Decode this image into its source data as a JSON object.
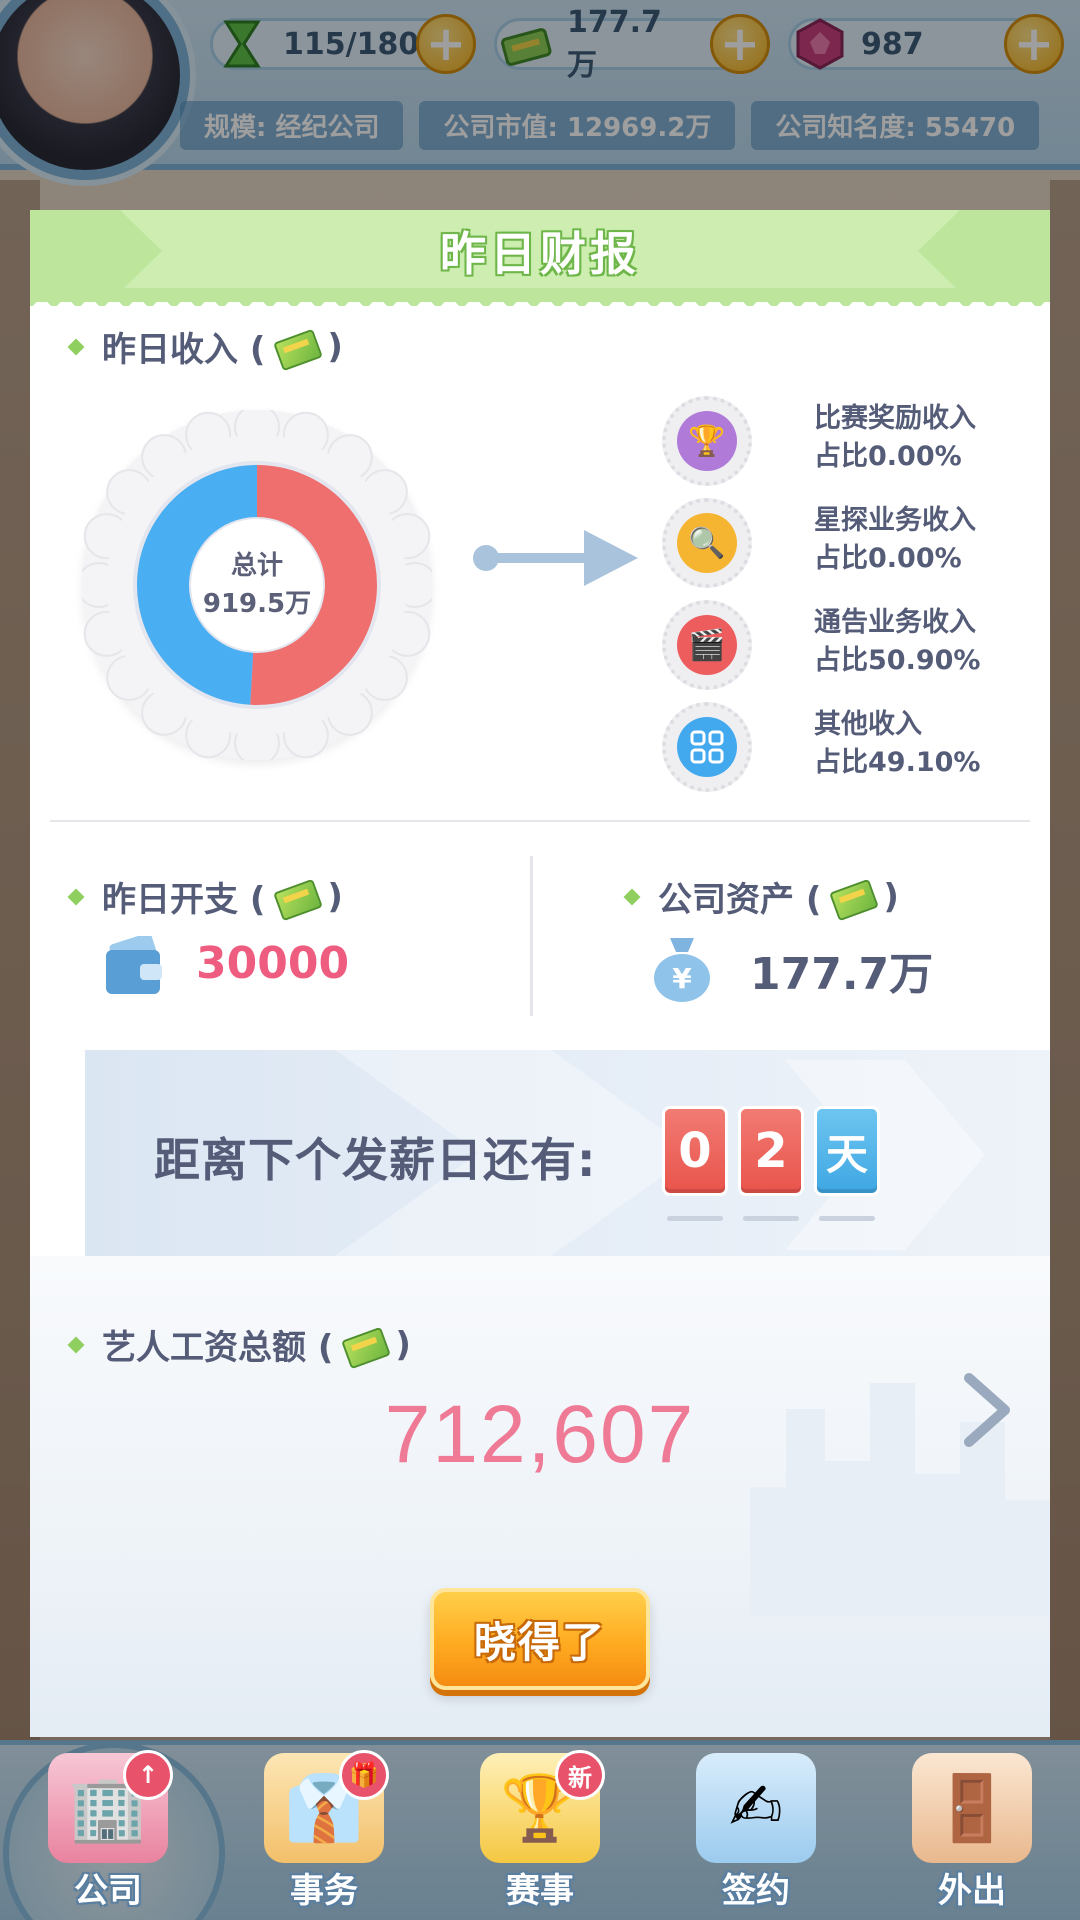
{
  "status": {
    "stamina": "115/180",
    "money": "177.7万",
    "gems": "987",
    "scale": "规模: 经纪公司",
    "market_value": "公司市值: 12969.2万",
    "fame": "公司知名度: 55470"
  },
  "modal": {
    "title": "昨日财报",
    "income": {
      "section_label": "昨日收入 (",
      "section_close": ")",
      "total_label": "总计",
      "total_value": "919.5万",
      "breakdown": [
        {
          "name": "比赛奖励收入",
          "share": "占比0.00%",
          "icon": "trophy-icon",
          "color": "#b07bd8"
        },
        {
          "name": "星探业务收入",
          "share": "占比0.00%",
          "icon": "magnifier-icon",
          "color": "#f5b531"
        },
        {
          "name": "通告业务收入",
          "share": "占比50.90%",
          "icon": "clapperboard-icon",
          "color": "#ee5d5d"
        },
        {
          "name": "其他收入",
          "share": "占比49.10%",
          "icon": "grid-icon",
          "color": "#43a9ee"
        }
      ]
    },
    "expense": {
      "section_label": "昨日开支 (",
      "section_close": ")",
      "value": "30000"
    },
    "assets": {
      "section_label": "公司资产 (",
      "section_close": ")",
      "value": "177.7万"
    },
    "payday": {
      "label": "距离下个发薪日还有:",
      "digit1": "0",
      "digit2": "2",
      "unit": "天"
    },
    "salary": {
      "section_label": "艺人工资总额 (",
      "section_close": ")",
      "value": "712,607"
    },
    "ok_button": "晓得了"
  },
  "chart_data": {
    "type": "pie",
    "categories": [
      "比赛奖励收入",
      "星探业务收入",
      "通告业务收入",
      "其他收入"
    ],
    "values": [
      0.0,
      0.0,
      50.9,
      49.1
    ],
    "colors": [
      "#b07bd8",
      "#f5b531",
      "#ef6f6f",
      "#4aaef2"
    ]
  },
  "nav": [
    {
      "label": "公司",
      "badge": "↑",
      "active": true
    },
    {
      "label": "事务",
      "badge": "🎁",
      "active": false
    },
    {
      "label": "赛事",
      "badge": "新",
      "active": false
    },
    {
      "label": "签约",
      "badge": "",
      "active": false
    },
    {
      "label": "外出",
      "badge": "",
      "active": false
    }
  ],
  "colors": {
    "header_green": "#bde59c",
    "text": "#555c78",
    "expense_pink": "#ee5d80",
    "salary_pink": "#ee7a96",
    "button_orange": "#ffab21"
  }
}
